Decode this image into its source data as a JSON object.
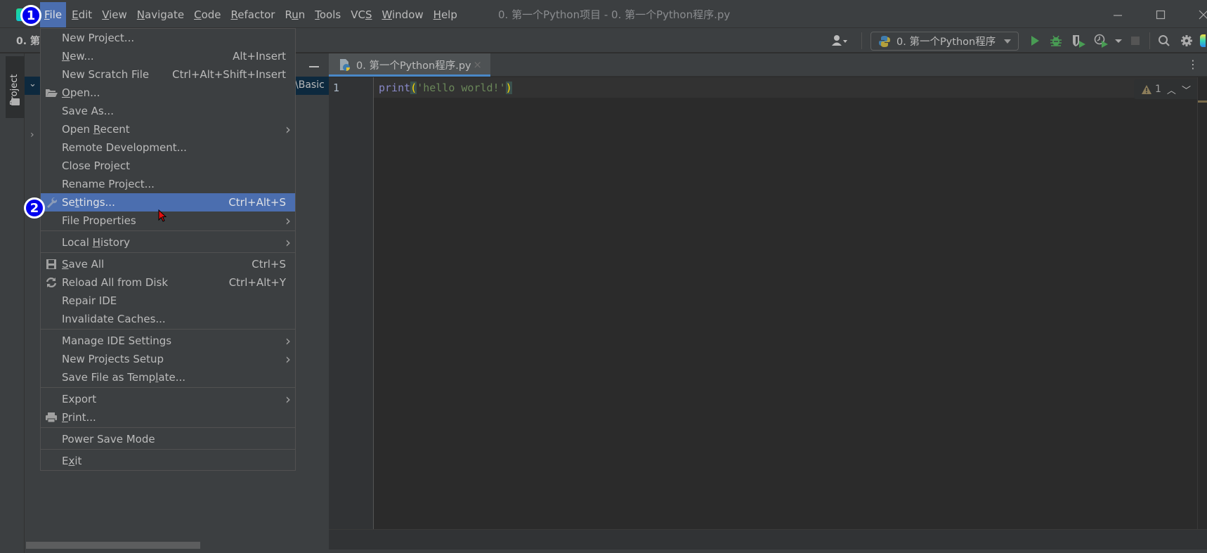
{
  "titlebar": {
    "menu": [
      "File",
      "Edit",
      "View",
      "Navigate",
      "Code",
      "Refactor",
      "Run",
      "Tools",
      "VCS",
      "Window",
      "Help"
    ],
    "menu_mnemonics": [
      "F",
      "E",
      "V",
      "N",
      "C",
      "R",
      "u",
      "T",
      "S",
      "W",
      "H"
    ],
    "active_menu": "File",
    "window_title": "0. 第一个Python项目 - 0. 第一个Python程序.py",
    "window_controls": [
      "minimize-icon",
      "maximize-icon",
      "close-icon"
    ]
  },
  "toolbar": {
    "project_crumb": "0. 第",
    "run_config_label": "0. 第一个Python程序",
    "icons": [
      "user-icon",
      "run-icon",
      "debug-icon",
      "coverage-icon",
      "profile-icon",
      "stop-icon",
      "search-icon",
      "settings-icon"
    ]
  },
  "tool_strip": {
    "project_tab_label": "Project"
  },
  "project_panel": {
    "path_fragment": "\\Basic"
  },
  "editor": {
    "tab_label": "0. 第一个Python程序.py",
    "line_numbers": [
      "1"
    ],
    "code": {
      "func": "print",
      "open_paren": "(",
      "string": "'hello world!'",
      "close_paren": ")"
    },
    "warning_count": "1"
  },
  "file_menu": {
    "items": [
      {
        "label": "New Project...",
        "shortcut": "",
        "submenu": false,
        "icon": ""
      },
      {
        "label": "New...",
        "shortcut": "Alt+Insert",
        "submenu": false,
        "icon": ""
      },
      {
        "label": "New Scratch File",
        "shortcut": "Ctrl+Alt+Shift+Insert",
        "submenu": false,
        "icon": ""
      },
      {
        "label": "Open...",
        "shortcut": "",
        "submenu": false,
        "icon": "folder-open-icon"
      },
      {
        "label": "Save As...",
        "shortcut": "",
        "submenu": false,
        "icon": ""
      },
      {
        "label": "Open Recent",
        "shortcut": "",
        "submenu": true,
        "icon": ""
      },
      {
        "label": "Remote Development...",
        "shortcut": "",
        "submenu": false,
        "icon": ""
      },
      {
        "label": "Close Project",
        "shortcut": "",
        "submenu": false,
        "icon": ""
      },
      {
        "label": "Rename Project...",
        "shortcut": "",
        "submenu": false,
        "icon": ""
      },
      {
        "label": "Settings...",
        "shortcut": "Ctrl+Alt+S",
        "submenu": false,
        "icon": "wrench-icon",
        "selected": true
      },
      {
        "label": "File Properties",
        "shortcut": "",
        "submenu": true,
        "icon": ""
      },
      {
        "label": "Local History",
        "shortcut": "",
        "submenu": true,
        "icon": ""
      },
      {
        "label": "Save All",
        "shortcut": "Ctrl+S",
        "submenu": false,
        "icon": "save-icon"
      },
      {
        "label": "Reload All from Disk",
        "shortcut": "Ctrl+Alt+Y",
        "submenu": false,
        "icon": "reload-icon"
      },
      {
        "label": "Repair IDE",
        "shortcut": "",
        "submenu": false,
        "icon": ""
      },
      {
        "label": "Invalidate Caches...",
        "shortcut": "",
        "submenu": false,
        "icon": ""
      },
      {
        "label": "Manage IDE Settings",
        "shortcut": "",
        "submenu": true,
        "icon": ""
      },
      {
        "label": "New Projects Setup",
        "shortcut": "",
        "submenu": true,
        "icon": ""
      },
      {
        "label": "Save File as Template...",
        "shortcut": "",
        "submenu": false,
        "icon": ""
      },
      {
        "label": "Export",
        "shortcut": "",
        "submenu": true,
        "icon": ""
      },
      {
        "label": "Print...",
        "shortcut": "",
        "submenu": false,
        "icon": "print-icon"
      },
      {
        "label": "Power Save Mode",
        "shortcut": "",
        "submenu": false,
        "icon": ""
      },
      {
        "label": "Exit",
        "shortcut": "",
        "submenu": false,
        "icon": ""
      }
    ]
  },
  "annotations": {
    "step1": "1",
    "step2": "2"
  },
  "colors": {
    "selection": "#4b6eaf",
    "tab_underline": "#4a88c7",
    "run_green": "#499c54",
    "annotation_blue": "#0000ee"
  }
}
